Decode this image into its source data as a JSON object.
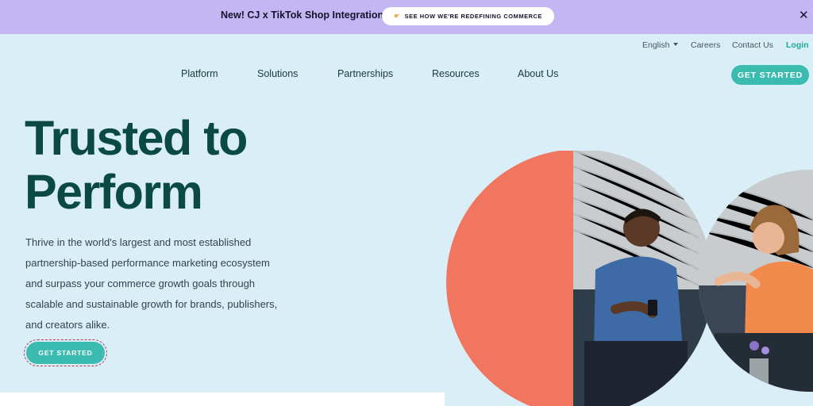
{
  "promo": {
    "text": "New! CJ x TikTok Shop Integration",
    "button_label": "SEE HOW WE'RE REDEFINING COMMERCE",
    "button_icon": "pointing-hand-icon",
    "close_icon": "close-icon",
    "background_color": "#c3b6f3"
  },
  "utility_nav": {
    "language": "English",
    "careers": "Careers",
    "contact": "Contact Us",
    "login": "Login"
  },
  "main_nav": {
    "items": [
      "Platform",
      "Solutions",
      "Partnerships",
      "Resources",
      "About Us"
    ],
    "cta": "GET STARTED"
  },
  "hero": {
    "title_lines": [
      "Trusted to",
      "Perform"
    ],
    "body_lines": [
      "Thrive in the world's largest and most established",
      "partnership-based performance marketing ecosystem",
      "and surpass your commerce growth goals through",
      "scalable and sustainable growth for brands, publishers,",
      "and creators alike."
    ],
    "cta": "GET STARTED"
  },
  "colors": {
    "accent": "#3cbcb0",
    "heading": "#0b4a42",
    "coral": "#f07660",
    "page_background": "#daeef8"
  }
}
